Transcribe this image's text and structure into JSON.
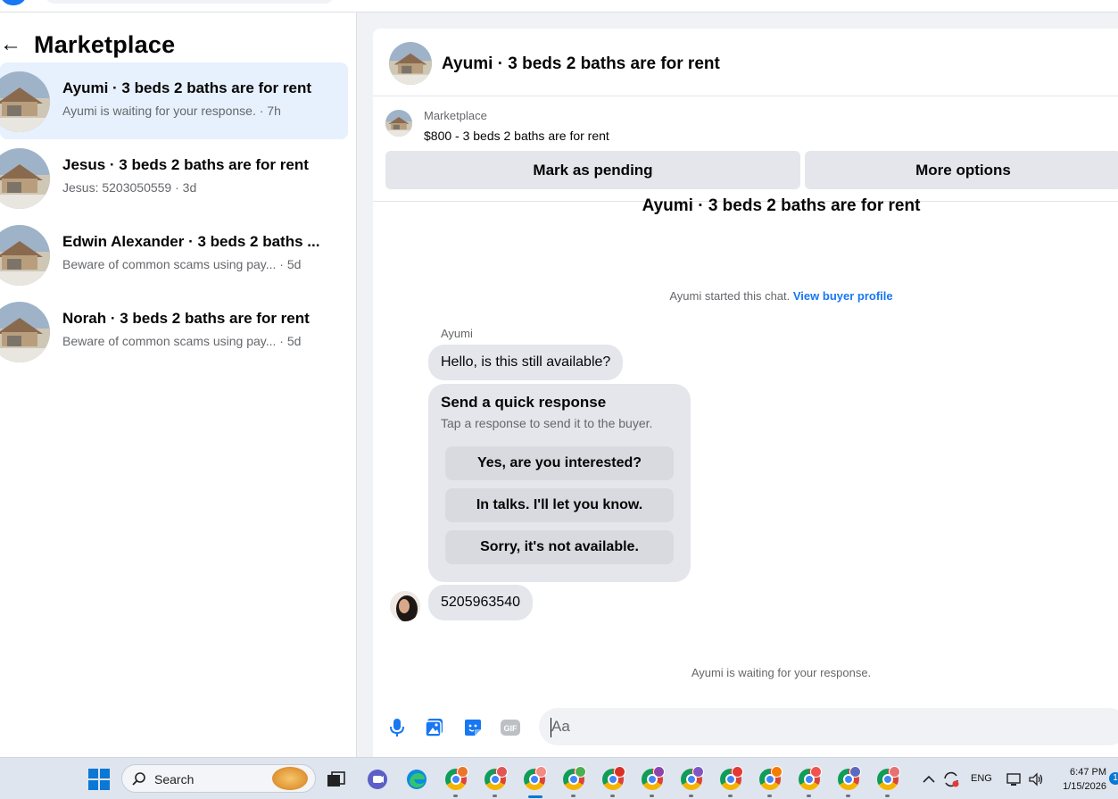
{
  "sidebar": {
    "title": "Marketplace",
    "conversations": [
      {
        "name": "Ayumi · 3 beds 2 baths are for rent",
        "preview": "Ayumi is waiting for your response. · 7h",
        "active": true
      },
      {
        "name": "Jesus · 3 beds 2 baths are for rent",
        "preview": "Jesus: 5203050559 · 3d",
        "active": false
      },
      {
        "name": "Edwin Alexander · 3 beds 2 baths ...",
        "preview": "Beware of common scams using pay...  · 5d",
        "active": false
      },
      {
        "name": "Norah · 3 beds 2 baths are for rent",
        "preview": "Beware of common scams using pay...  · 5d",
        "active": false
      }
    ]
  },
  "chat": {
    "header_title": "Ayumi · 3 beds 2 baths are for rent",
    "listing": {
      "source": "Marketplace",
      "title": "$800 - 3 beds 2 baths are for rent"
    },
    "buttons": {
      "mark_pending": "Mark as pending",
      "more_options": "More options"
    },
    "thread_title": "Ayumi · 3 beds 2 baths are for rent",
    "system_message": "Ayumi started this chat.",
    "system_link": "View buyer profile",
    "sender_name": "Ayumi",
    "first_message": "Hello, is this still available?",
    "quick_response": {
      "title": "Send a quick response",
      "subtitle": "Tap a response to send it to the buyer.",
      "options": [
        "Yes, are you interested?",
        "In talks. I'll let you know.",
        "Sorry, it's not available."
      ]
    },
    "reply_message": "5205963540",
    "waiting_message": "Ayumi is waiting for your response.",
    "composer": {
      "placeholder": "Aa",
      "icons": [
        "microphone-icon",
        "photo-icon",
        "sticker-icon",
        "gif-icon"
      ],
      "gif_label": "GIF"
    }
  },
  "taskbar": {
    "search_label": "Search",
    "tray": {
      "language": "ENG",
      "time": "6:47 PM",
      "date": "1/15/2026",
      "notification_count": "1"
    },
    "colors": {
      "accent": "#0a78d4",
      "messenger_blue": "#1877f2"
    }
  }
}
